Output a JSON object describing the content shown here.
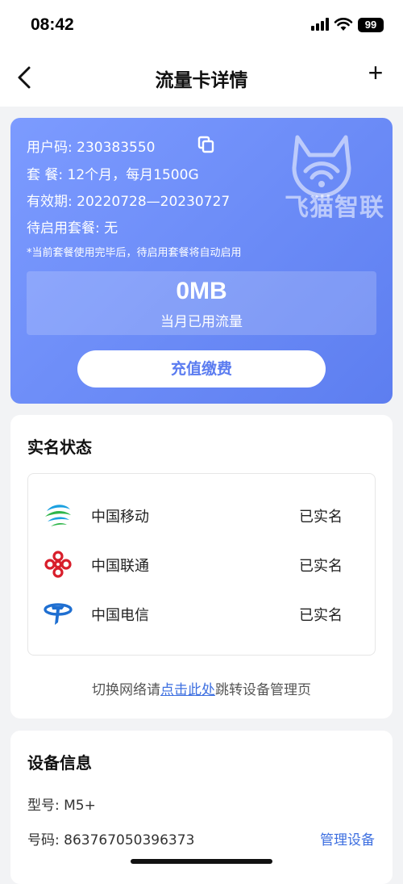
{
  "status_bar": {
    "time": "08:42",
    "battery": "99"
  },
  "nav": {
    "title": "流量卡详情",
    "add_label": "+"
  },
  "card": {
    "user_code_label": "用户码:",
    "user_code": "230383550",
    "package_label": "套    餐:",
    "package": "12个月，每月1500G",
    "validity_label": "有效期:",
    "validity": "20220728—20230727",
    "pending_label": "待启用套餐:",
    "pending": "无",
    "note": "*当前套餐使用完毕后，待启用套餐将自动启用",
    "usage_value": "0MB",
    "usage_label": "当月已用流量",
    "recharge_label": "充值缴费",
    "brand": "飞猫智联"
  },
  "realname": {
    "title": "实名状态",
    "carriers": [
      {
        "name": "中国移动",
        "status": "已实名",
        "icon": "china-mobile-logo"
      },
      {
        "name": "中国联通",
        "status": "已实名",
        "icon": "china-unicom-logo"
      },
      {
        "name": "中国电信",
        "status": "已实名",
        "icon": "china-telecom-logo"
      }
    ],
    "hint_before": "切换网络请",
    "hint_link": "点击此处",
    "hint_after": "跳转设备管理页"
  },
  "device": {
    "title": "设备信息",
    "model_label": "型号:",
    "model": "M5+",
    "number_label": "号码:",
    "number": "863767050396373",
    "manage_label": "管理设备"
  },
  "colors": {
    "card_blue": "#6a8cf8",
    "link": "#3d6fe0",
    "unicom_red": "#d81e2b",
    "telecom_blue": "#1f6fd1"
  }
}
